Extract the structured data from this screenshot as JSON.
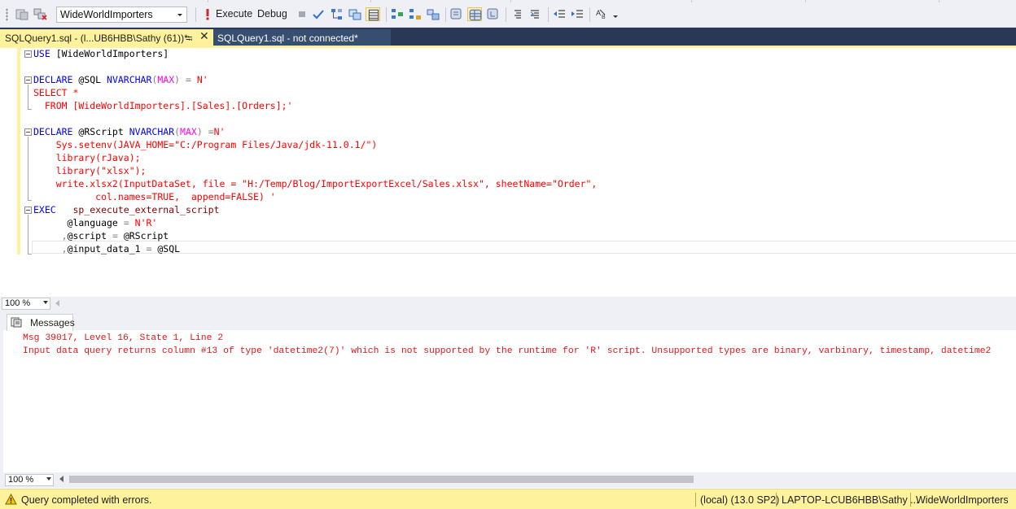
{
  "toolbar": {
    "database": "WideWorldImporters",
    "execute_label": "Execute",
    "debug_label": "Debug",
    "icons": [
      "new-query-icon",
      "object-explorer-icon",
      "connect-icon",
      "execute-icon",
      "stop-icon",
      "parse-icon",
      "display-plan-icon",
      "query-designer-icon",
      "results-to-grid-icon",
      "include-stats-icon",
      "client-stats-icon",
      "actual-plan-icon",
      "results-to-text-icon",
      "results-to-file-icon",
      "comment-icon",
      "uncomment-icon",
      "decrease-indent-icon",
      "increase-indent-icon",
      "specify-values-icon"
    ]
  },
  "tabs": [
    {
      "label": "SQLQuery1.sql - (l...UB6HBB\\Sathy (61))*",
      "active": true
    },
    {
      "label": "SQLQuery1.sql - not connected*",
      "active": false
    }
  ],
  "editor": {
    "lines": [
      [
        "kw:USE",
        "t: [WideWorldImporters]"
      ],
      [],
      [
        "kw:DECLARE",
        "t: @SQL ",
        "kw:NVARCHAR",
        "gray:(",
        "sys:MAX",
        "gray:)",
        "t: ",
        "gray:=",
        "t: ",
        "str:N'"
      ],
      [
        "str:SELECT *"
      ],
      [
        "str:  FROM [WideWorldImporters].[Sales].[Orders];'"
      ],
      [],
      [
        "kw:DECLARE",
        "t: @RScript ",
        "kw:NVARCHAR",
        "gray:(",
        "sys:MAX",
        "gray:)",
        "t: ",
        "gray:=",
        "str:N'"
      ],
      [
        "str:    Sys.setenv(JAVA_HOME=\"C:/Program Files/Java/jdk-11.0.1/\")"
      ],
      [
        "str:    library(rJava);"
      ],
      [
        "str:    library(\"xlsx\");"
      ],
      [
        "str:    write.xlsx2(InputDataSet, file = \"H:/Temp/Blog/ImportExportExcel/Sales.xlsx\", sheetName=\"Order\","
      ],
      [
        "str:           col.names=TRUE,  append=FALSE) '"
      ],
      [
        "kw:EXEC",
        "t:   ",
        "fn:sp_execute_external_script"
      ],
      [
        "t:      @language ",
        "gray:=",
        "t: ",
        "str:N'R'"
      ],
      [
        "t:     ",
        "gray:,",
        "t:@script ",
        "gray:=",
        "t: @RScript"
      ],
      [
        "t:     ",
        "gray:,",
        "t:@input_data_1 ",
        "gray:=",
        "t: @SQL"
      ]
    ]
  },
  "editor_zoom": "100 %",
  "results": {
    "tab_label": "Messages",
    "messages": [
      "Msg 39017, Level 16, State 1, Line 2",
      "Input data query returns column #13 of type 'datetime2(7)' which is not supported by the runtime for 'R' script. Unsupported types are binary, varbinary, timestamp, datetime2"
    ]
  },
  "results_zoom": "100 %",
  "status": {
    "message": "Query completed with errors.",
    "server": "(local) (13.0 SP2)",
    "user": "LAPTOP-LCUB6HBB\\Sathy ...",
    "database": "WideWorldImporters"
  },
  "colors": {
    "tab_active": "#fff29d",
    "tab_bar": "#293955",
    "keyword": "#0000ff",
    "string": "#ff0000",
    "error_text": "#e01818"
  }
}
